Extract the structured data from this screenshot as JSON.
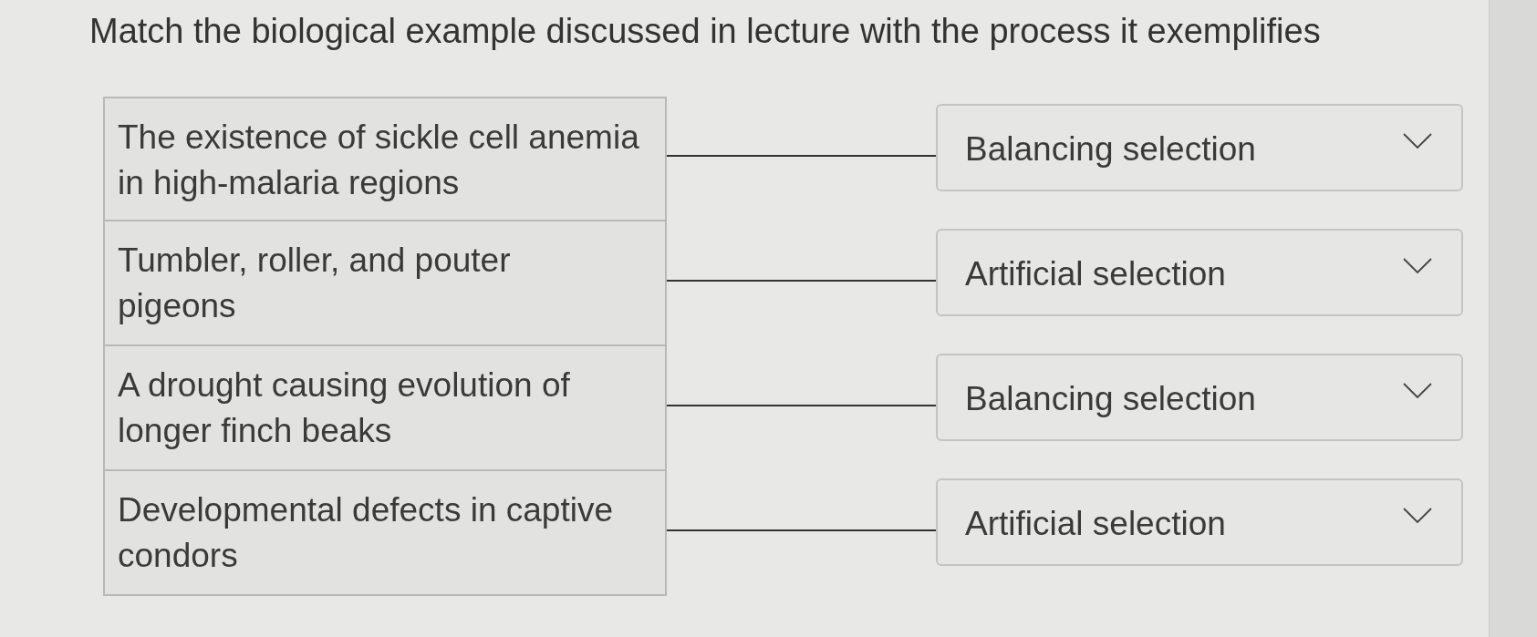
{
  "prompt": "Match the biological example discussed in lecture with the process it exemplifies",
  "pairs": [
    {
      "example": "The existence of sickle cell anemia\nin high-malaria regions",
      "answer": "Balancing selection"
    },
    {
      "example": "Tumbler, roller, and pouter\npigeons",
      "answer": "Artificial selection"
    },
    {
      "example": "A drought causing evolution of\nlonger finch beaks",
      "answer": "Balancing selection"
    },
    {
      "example": "Developmental defects in captive\ncondors",
      "answer": "Artificial selection"
    }
  ]
}
